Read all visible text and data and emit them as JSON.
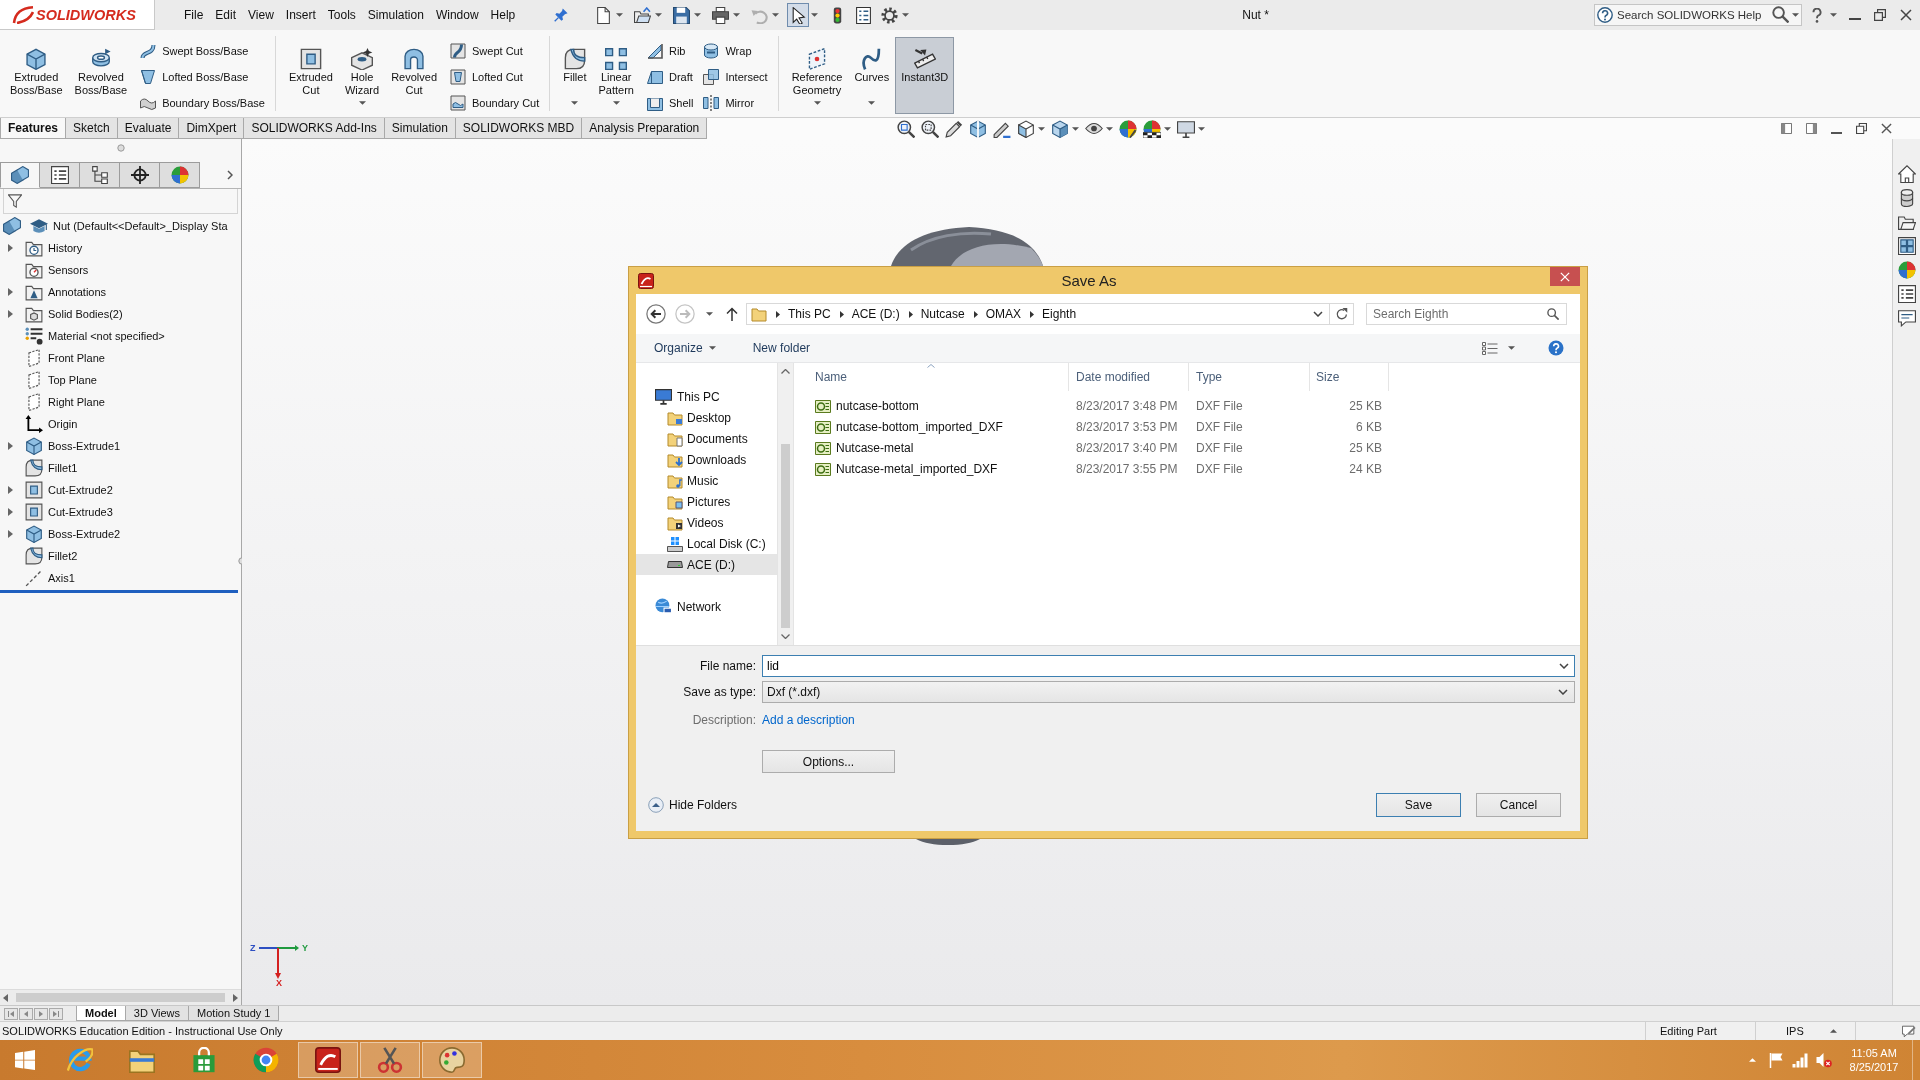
{
  "window": {
    "logo": "SOLIDWORKS",
    "menu": [
      "File",
      "Edit",
      "View",
      "Insert",
      "Tools",
      "Simulation",
      "Window",
      "Help"
    ],
    "title": "Nut *",
    "help_search": {
      "placeholder": "Search SOLIDWORKS Help"
    }
  },
  "quick_access": [
    {
      "kind": "new",
      "dropdown": true,
      "disabled": false,
      "pressed": false
    },
    {
      "kind": "open",
      "dropdown": true,
      "disabled": false,
      "pressed": false
    },
    {
      "kind": "save",
      "dropdown": true,
      "disabled": false,
      "pressed": false
    },
    {
      "kind": "print",
      "dropdown": true,
      "disabled": false,
      "pressed": false
    },
    {
      "kind": "undo",
      "dropdown": true,
      "disabled": true,
      "pressed": false
    },
    {
      "kind": "select",
      "dropdown": true,
      "disabled": false,
      "pressed": true
    },
    {
      "kind": "rebuild",
      "dropdown": false,
      "disabled": false,
      "pressed": false
    },
    {
      "kind": "file-properties",
      "dropdown": false,
      "disabled": false,
      "pressed": false
    },
    {
      "kind": "options",
      "dropdown": true,
      "disabled": false,
      "pressed": false
    }
  ],
  "ribbon": [
    {
      "large": [
        {
          "label": "Extruded Boss/Base",
          "kind": "extrude-boss",
          "dropdown": false,
          "pressed": false
        },
        {
          "label": "Revolved Boss/Base",
          "kind": "revolve-boss",
          "dropdown": false,
          "pressed": false
        }
      ],
      "columns": [
        [
          {
            "label": "Swept Boss/Base",
            "kind": "swept-boss"
          },
          {
            "label": "Lofted Boss/Base",
            "kind": "lofted-boss"
          },
          {
            "label": "Boundary Boss/Base",
            "kind": "boundary-boss"
          }
        ]
      ]
    },
    {
      "large": [
        {
          "label": "Extruded Cut",
          "kind": "extrude-cut",
          "dropdown": false,
          "pressed": false
        },
        {
          "label": "Hole Wizard",
          "kind": "hole-wizard",
          "dropdown": true,
          "pressed": false
        },
        {
          "label": "Revolved Cut",
          "kind": "revolve-cut",
          "dropdown": false,
          "pressed": false
        }
      ],
      "columns": [
        [
          {
            "label": "Swept Cut",
            "kind": "swept-cut"
          },
          {
            "label": "Lofted Cut",
            "kind": "lofted-cut"
          },
          {
            "label": "Boundary Cut",
            "kind": "boundary-cut"
          }
        ]
      ]
    },
    {
      "large": [
        {
          "label": "Fillet",
          "kind": "fillet",
          "dropdown": true,
          "pressed": false
        },
        {
          "label": "Linear Pattern",
          "kind": "linear-pattern",
          "dropdown": true,
          "pressed": false
        }
      ],
      "columns": [
        [
          {
            "label": "Rib",
            "kind": "rib"
          },
          {
            "label": "Draft",
            "kind": "draft"
          },
          {
            "label": "Shell",
            "kind": "shell"
          }
        ],
        [
          {
            "label": "Wrap",
            "kind": "wrap"
          },
          {
            "label": "Intersect",
            "kind": "intersect"
          },
          {
            "label": "Mirror",
            "kind": "mirror"
          }
        ]
      ]
    },
    {
      "large": [
        {
          "label": "Reference Geometry",
          "kind": "reference-geometry",
          "dropdown": true,
          "pressed": false
        },
        {
          "label": "Curves",
          "kind": "curves",
          "dropdown": true,
          "pressed": false
        },
        {
          "label": "Instant3D",
          "kind": "instant3d",
          "dropdown": false,
          "pressed": true
        }
      ]
    }
  ],
  "command_tabs": [
    {
      "label": "Features",
      "selected": true
    },
    {
      "label": "Sketch",
      "selected": false
    },
    {
      "label": "Evaluate",
      "selected": false
    },
    {
      "label": "DimXpert",
      "selected": false
    },
    {
      "label": "SOLIDWORKS Add-Ins",
      "selected": false
    },
    {
      "label": "Simulation",
      "selected": false
    },
    {
      "label": "SOLIDWORKS MBD",
      "selected": false
    },
    {
      "label": "Analysis Preparation",
      "selected": false
    }
  ],
  "feature_manager": {
    "tabs": [
      {
        "kind": "features",
        "selected": true
      },
      {
        "kind": "properties",
        "selected": false
      },
      {
        "kind": "configurations",
        "selected": false
      },
      {
        "kind": "dimxpert",
        "selected": false
      },
      {
        "kind": "display",
        "selected": false
      }
    ],
    "tree": {
      "label": "Nut (Default<<Default>_Display Sta",
      "kind": "part",
      "children": [
        {
          "label": "History",
          "kind": "history",
          "expanded": false
        },
        {
          "label": "Sensors",
          "kind": "sensors"
        },
        {
          "label": "Annotations",
          "kind": "annotations",
          "expanded": false
        },
        {
          "label": "Solid Bodies(2)",
          "kind": "bodies",
          "expanded": false
        },
        {
          "label": "Material <not specified>",
          "kind": "material"
        },
        {
          "label": "Front Plane",
          "kind": "plane"
        },
        {
          "label": "Top Plane",
          "kind": "plane"
        },
        {
          "label": "Right Plane",
          "kind": "plane"
        },
        {
          "label": "Origin",
          "kind": "origin"
        },
        {
          "label": "Boss-Extrude1",
          "kind": "boss-extrude",
          "expanded": false
        },
        {
          "label": "Fillet1",
          "kind": "fillet"
        },
        {
          "label": "Cut-Extrude2",
          "kind": "cut-extrude",
          "expanded": false
        },
        {
          "label": "Cut-Extrude3",
          "kind": "cut-extrude",
          "expanded": false
        },
        {
          "label": "Boss-Extrude2",
          "kind": "boss-extrude",
          "expanded": false
        },
        {
          "label": "Fillet2",
          "kind": "fillet"
        },
        {
          "label": "Axis1",
          "kind": "axis"
        }
      ]
    }
  },
  "viewport": {
    "triad_labels": [
      "Z",
      "Y",
      "X"
    ]
  },
  "save_dialog": {
    "title": "Save As",
    "breadcrumb": [
      "This PC",
      "ACE (D:)",
      "Nutcase",
      "OMAX",
      "Eighth"
    ],
    "search": {
      "placeholder": "Search Eighth"
    },
    "commands": [
      {
        "label": "Organize",
        "dropdown": true
      },
      {
        "label": "New folder",
        "dropdown": false
      }
    ],
    "nav": [
      {
        "label": "This PC",
        "kind": "computer",
        "selected": false,
        "children": [
          {
            "label": "Desktop",
            "kind": "desktop",
            "selected": false
          },
          {
            "label": "Documents",
            "kind": "documents",
            "selected": false
          },
          {
            "label": "Downloads",
            "kind": "downloads",
            "selected": false
          },
          {
            "label": "Music",
            "kind": "music",
            "selected": false
          },
          {
            "label": "Pictures",
            "kind": "pictures",
            "selected": false
          },
          {
            "label": "Videos",
            "kind": "videos",
            "selected": false
          },
          {
            "label": "Local Disk (C:)",
            "kind": "windows-drive",
            "selected": false
          },
          {
            "label": "ACE (D:)",
            "kind": "drive",
            "selected": true
          }
        ]
      },
      {
        "label": "Network",
        "kind": "network",
        "selected": false
      }
    ],
    "columns": [
      {
        "label": "Name",
        "sorted": true
      },
      {
        "label": "Date modified",
        "sorted": false
      },
      {
        "label": "Type",
        "sorted": false
      },
      {
        "label": "Size",
        "sorted": false
      }
    ],
    "files": [
      {
        "name": "nutcase-bottom",
        "date_modified": "8/23/2017 3:48 PM",
        "type": "DXF File",
        "size": "25 KB"
      },
      {
        "name": "nutcase-bottom_imported_DXF",
        "date_modified": "8/23/2017 3:53 PM",
        "type": "DXF File",
        "size": "6 KB"
      },
      {
        "name": "Nutcase-metal",
        "date_modified": "8/23/2017 3:40 PM",
        "type": "DXF File",
        "size": "25 KB"
      },
      {
        "name": "Nutcase-metal_imported_DXF",
        "date_modified": "8/23/2017 3:55 PM",
        "type": "DXF File",
        "size": "24 KB"
      }
    ],
    "fields": [
      {
        "label": "File name:",
        "kind": "combo",
        "value": "lid",
        "focused": true
      },
      {
        "label": "Save as type:",
        "kind": "select",
        "value": "Dxf (*.dxf)",
        "focused": false
      }
    ],
    "description": {
      "label": "Description:",
      "link": "Add a description"
    },
    "options": "Options...",
    "hide_folders": "Hide Folders",
    "buttons": [
      {
        "label": "Save",
        "default": true
      },
      {
        "label": "Cancel",
        "default": false
      }
    ]
  },
  "bottom_tabs": [
    {
      "label": "Model",
      "selected": true
    },
    {
      "label": "3D Views",
      "selected": false
    },
    {
      "label": "Motion Study 1",
      "selected": false
    }
  ],
  "status_bar": {
    "edition": "SOLIDWORKS Education Edition - Instructional Use Only",
    "mode": "Editing Part",
    "units": "IPS"
  },
  "taskbar": {
    "apps": [
      {
        "kind": "e-browser",
        "running": false
      },
      {
        "kind": "files",
        "running": false
      },
      {
        "kind": "store",
        "running": false
      },
      {
        "kind": "circle-browser",
        "running": false
      },
      {
        "kind": "cad",
        "running": true
      },
      {
        "kind": "snip",
        "running": true
      },
      {
        "kind": "paint",
        "running": true
      }
    ],
    "tray": {
      "muted": true,
      "time": "11:05 AM",
      "date": "8/25/2017"
    }
  }
}
